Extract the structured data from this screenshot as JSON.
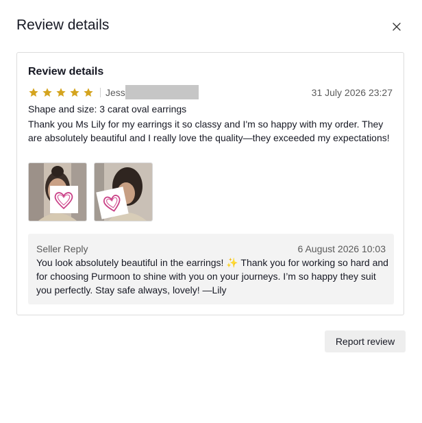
{
  "modal": {
    "title": "Review details",
    "close_icon": "close-icon"
  },
  "review": {
    "card_title": "Review details",
    "rating": 5,
    "rating_max": 5,
    "star_color": "#d4a41f",
    "reviewer_name": "Jess",
    "date": "31 July 2026 23:27",
    "variant": "Shape and size: 3 carat oval earrings",
    "text": "Thank you Ms Lily for my earrings it so classy and I'm so happy with my order. They are absolutely beautiful and I really love the quality—they exceeded my expectations!",
    "photos": [
      "review-photo-1",
      "review-photo-2"
    ]
  },
  "seller_reply": {
    "label": "Seller Reply",
    "date": "6 August 2026 10:03",
    "text": "You look absolutely beautiful in the earrings! ✨ Thank you for working so hard and for choosing Purmoon to shine with you on your journeys. I’m so happy they suit you perfectly. Stay safe always, lovely! —Lily"
  },
  "actions": {
    "report_label": "Report review"
  }
}
